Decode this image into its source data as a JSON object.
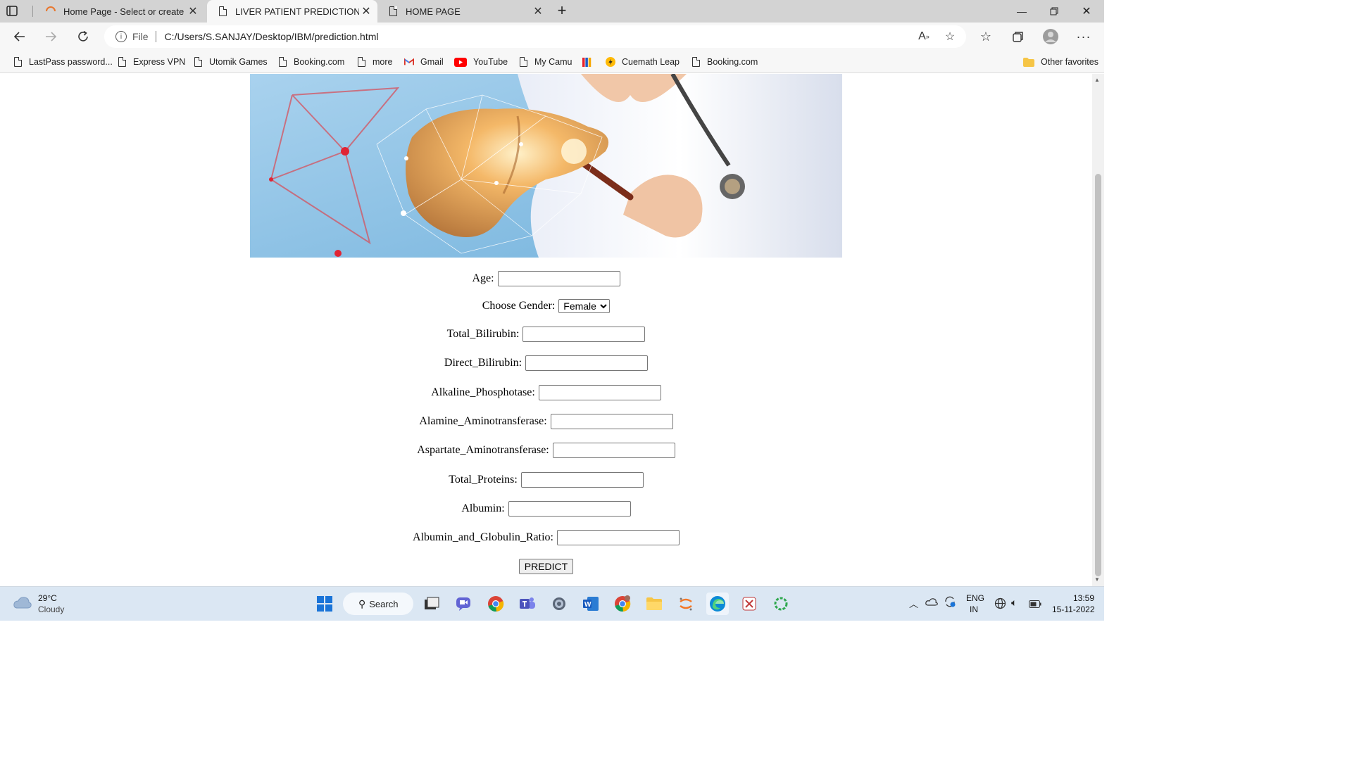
{
  "browser": {
    "tabs": [
      {
        "title": "Home Page - Select or create a n",
        "icon": "loading-spinner-icon",
        "active": false
      },
      {
        "title": "LIVER PATIENT PREDICTION",
        "icon": "page-icon",
        "active": true
      },
      {
        "title": "HOME PAGE",
        "icon": "page-icon",
        "active": false
      }
    ],
    "address": {
      "scheme_label": "File",
      "url": "C:/Users/S.SANJAY/Desktop/IBM/prediction.html"
    },
    "bookmarks": [
      {
        "label": "LastPass password...",
        "icon": "page-icon"
      },
      {
        "label": "Express VPN",
        "icon": "page-icon"
      },
      {
        "label": "Utomik Games",
        "icon": "page-icon"
      },
      {
        "label": "Booking.com",
        "icon": "page-icon"
      },
      {
        "label": "more",
        "icon": "page-icon"
      },
      {
        "label": "Gmail",
        "icon": "gmail-icon"
      },
      {
        "label": "YouTube",
        "icon": "youtube-icon"
      },
      {
        "label": "My Camu",
        "icon": "page-icon"
      },
      {
        "label": "",
        "icon": "colorful-bars-icon"
      },
      {
        "label": "Cuemath Leap",
        "icon": "cuemath-icon"
      },
      {
        "label": "Booking.com",
        "icon": "page-icon"
      }
    ],
    "other_favorites": "Other favorites"
  },
  "form": {
    "age_label": "Age:",
    "gender_label": "Choose Gender:",
    "gender_selected": "Female",
    "total_bilirubin_label": "Total_Bilirubin:",
    "direct_bilirubin_label": "Direct_Bilirubin:",
    "alkaline_phosphotase_label": "Alkaline_Phosphotase:",
    "alamine_label": "Alamine_Aminotransferase:",
    "aspartate_label": "Aspartate_Aminotransferase:",
    "total_proteins_label": "Total_Proteins:",
    "albumin_label": "Albumin:",
    "ratio_label": "Albumin_and_Globulin_Ratio:",
    "submit_label": "PREDICT"
  },
  "taskbar": {
    "weather_temp": "29°C",
    "weather_desc": "Cloudy",
    "search_label": "Search",
    "lang_line1": "ENG",
    "lang_line2": "IN",
    "time": "13:59",
    "date": "15-11-2022"
  }
}
